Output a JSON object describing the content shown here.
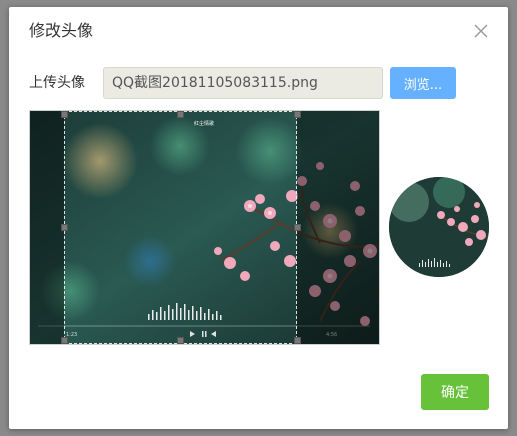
{
  "dialog": {
    "title": "修改头像",
    "close_icon": "close-icon"
  },
  "upload": {
    "label": "上传头像",
    "file_value": "QQ截图20181105083115.png",
    "browse_label": "浏览..."
  },
  "photo": {
    "song_title": "红尘情歌",
    "time_left": "1:23",
    "time_right": "4:56"
  },
  "actions": {
    "confirm_label": "确定"
  },
  "colors": {
    "browse_button": "#66b1ff",
    "confirm_button": "#67c23a",
    "file_input_bg": "#ebebe4"
  }
}
